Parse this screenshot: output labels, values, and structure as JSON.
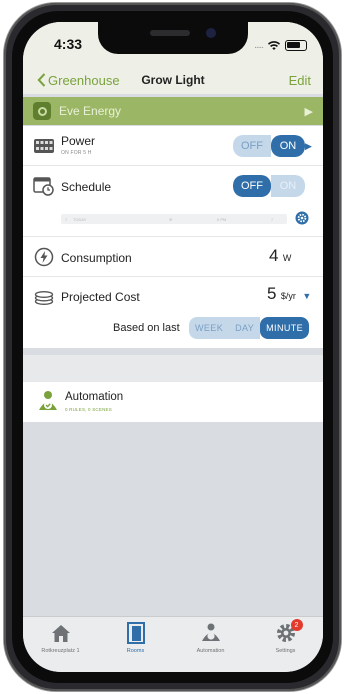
{
  "status_bar": {
    "time": "4:33",
    "signal_dots": "....."
  },
  "nav": {
    "back_label": "Greenhouse",
    "title": "Grow Light",
    "edit_label": "Edit"
  },
  "device": {
    "name": "Eve Energy"
  },
  "power": {
    "label": "Power",
    "subtitle": "ON FOR 5 H",
    "off_label": "OFF",
    "on_label": "ON",
    "state": "on"
  },
  "schedule": {
    "label": "Schedule",
    "off_label": "OFF",
    "on_label": "ON",
    "state": "off",
    "timeline": {
      "start": "TODAY",
      "marker": "6 PM"
    }
  },
  "consumption": {
    "label": "Consumption",
    "value": "4",
    "unit": "W"
  },
  "projected_cost": {
    "label": "Projected Cost",
    "value": "5",
    "unit": "$/yr",
    "based_label": "Based on last",
    "ranges": [
      "WEEK",
      "DAY",
      "MINUTE"
    ],
    "selected_range": "MINUTE"
  },
  "automation": {
    "label": "Automation",
    "subtitle": "0 RULES, 0 SCENES"
  },
  "tabs": [
    {
      "label": "Rotkreuzplatz 1",
      "icon": "house-icon"
    },
    {
      "label": "Rooms",
      "icon": "room-door-icon"
    },
    {
      "label": "Automation",
      "icon": "automation-icon"
    },
    {
      "label": "Settings",
      "icon": "gear-icon",
      "badge": "2"
    }
  ],
  "colors": {
    "accent_green": "#7aa23c",
    "device_bar": "#9bb665",
    "toggle_blue": "#2f6ea9",
    "badge_red": "#e23b2e"
  }
}
